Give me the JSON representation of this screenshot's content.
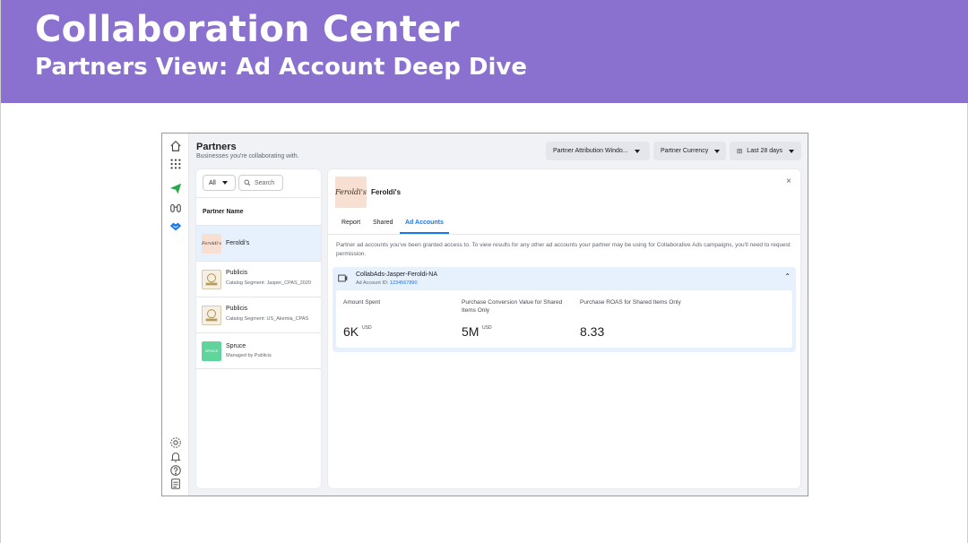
{
  "slide": {
    "title": "Collaboration Center",
    "subtitle": "Partners View: Ad Account Deep Dive"
  },
  "header": {
    "title": "Partners",
    "subtitle": "Businesses you're collaborating with.",
    "attribution_label": "Partner Attribution Windo...",
    "currency_label": "Partner Currency",
    "date_range_label": "Last 28 days"
  },
  "rail_icons": [
    "home-icon",
    "apps-grid-icon",
    "send-icon",
    "binoculars-icon",
    "handshake-icon",
    "settings-icon",
    "bell-icon",
    "help-icon",
    "report-icon"
  ],
  "list": {
    "filter_value": "All",
    "search_placeholder": "Search",
    "column_header": "Partner Name",
    "partners": [
      {
        "name": "Feroldi's",
        "sub": "",
        "logo_text": "Feroldi's",
        "selected": true
      },
      {
        "name": "Publicis",
        "sub": "Catalog Segment: Jasper_CPAS_2020",
        "logo_text": "PUBLICIS",
        "selected": false
      },
      {
        "name": "Publicis",
        "sub": "Catalog Segment: US_Akemia_CPAS",
        "logo_text": "PUBLICIS",
        "selected": false
      },
      {
        "name": "Spruce",
        "sub": "Managed by Publicis",
        "logo_text": "SPRUCE",
        "selected": false
      }
    ]
  },
  "detail": {
    "partner_name": "Feroldi's",
    "logo_text": "Feroldi's",
    "close_glyph": "×",
    "tabs": [
      "Report",
      "Shared",
      "Ad Accounts"
    ],
    "active_tab": "Ad Accounts",
    "notice": "Partner ad accounts you've been granted access to. To view results for any other ad accounts your partner may be using for Collaborative Ads campaigns, you'll need to request permission.",
    "account": {
      "name": "CollabAds-Jasper-Feroldi-NA",
      "id_label": "Ad Account ID:",
      "id": "1234567890",
      "metrics": [
        {
          "label": "Amount Spent",
          "value": "6K",
          "unit": "USD"
        },
        {
          "label": "Purchase Conversion Value for Shared Items Only",
          "value": "5M",
          "unit": "USD"
        },
        {
          "label": "Purchase ROAS for Shared Items Only",
          "value": "8.33",
          "unit": ""
        }
      ]
    }
  },
  "colors": {
    "banner": "#8b71cf",
    "accent": "#1877f2",
    "selected_row": "#e7f0fd"
  }
}
